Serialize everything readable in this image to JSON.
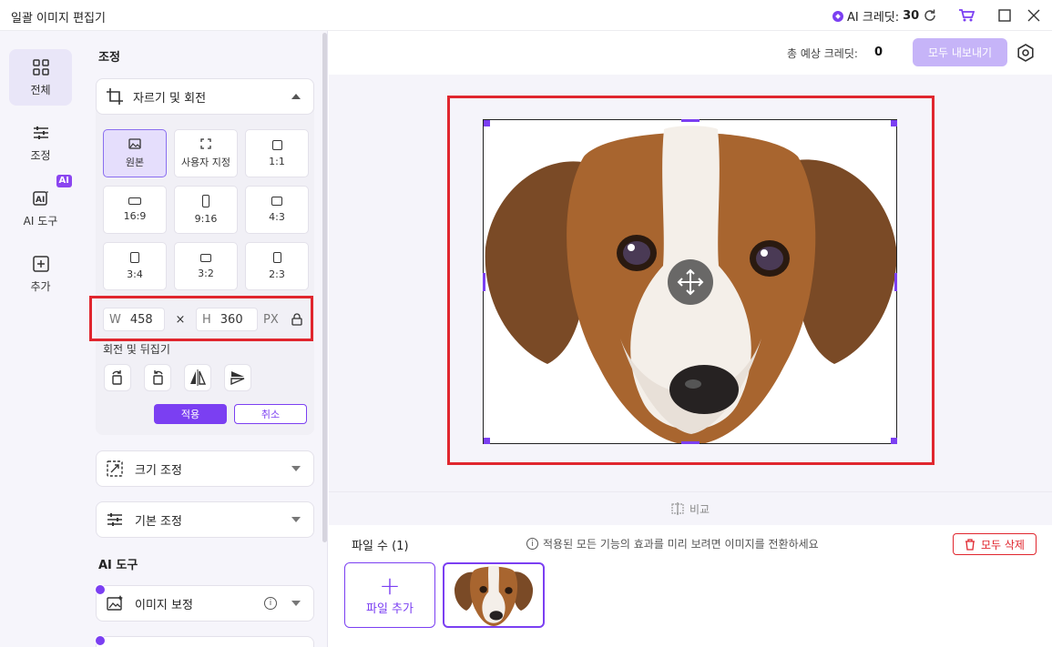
{
  "window": {
    "title": "일괄 이미지 편집기",
    "credits_label": "AI 크레딧:",
    "credits_value": "30"
  },
  "nav": {
    "items": [
      {
        "label": "전체",
        "icon": "grid-icon"
      },
      {
        "label": "조정",
        "icon": "sliders-icon"
      },
      {
        "label": "AI 도구",
        "icon": "ai-icon",
        "badge": "AI"
      },
      {
        "label": "추가",
        "icon": "plus-square-icon"
      }
    ]
  },
  "panel": {
    "section_adjust": "조정",
    "crop": {
      "title": "자르기 및 회전",
      "ratios": [
        {
          "label": "원본",
          "selected": true
        },
        {
          "label": "사용자 지정"
        },
        {
          "label": "1:1"
        },
        {
          "label": "16:9"
        },
        {
          "label": "9:16"
        },
        {
          "label": "4:3"
        },
        {
          "label": "3:4"
        },
        {
          "label": "3:2"
        },
        {
          "label": "2:3"
        }
      ],
      "width_label": "W",
      "width_value": "458",
      "times": "×",
      "height_label": "H",
      "height_value": "360",
      "unit": "PX",
      "rotate_title": "회전 및 뒤집기",
      "apply": "적용",
      "cancel": "취소"
    },
    "resize_title": "크기 조정",
    "basic_title": "기본 조정",
    "section_ai": "AI 도구",
    "enhance_title": "이미지 보정"
  },
  "main": {
    "estimate_label": "총 예상 크레딧:",
    "estimate_value": "0",
    "export_all": "모두 내보내기",
    "compare": "비교",
    "file_count": "파일 수 (1)",
    "tip": "적용된 모든 기능의 효과를 미리 보려면 이미지를 전환하세요",
    "delete_all": "모두 삭제",
    "add_file": "파일 추가"
  },
  "colors": {
    "accent": "#7b3ff2",
    "highlight": "#e0262e",
    "panel_bg": "#f6f5fb"
  }
}
